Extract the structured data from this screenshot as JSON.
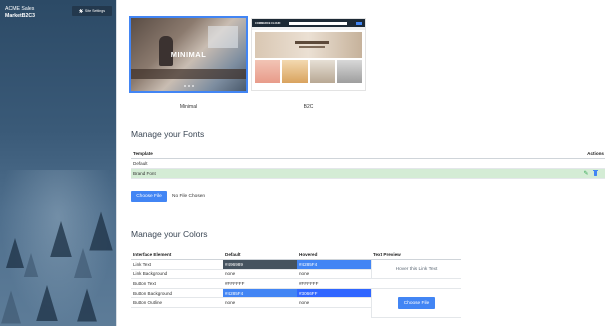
{
  "sidebar": {
    "app_name": "ACME Sales",
    "org_name": "MarketB2C3",
    "site_settings_label": "Site Settings"
  },
  "templates": [
    {
      "name": "Minimal",
      "overlay_text": "MINIMAL",
      "selected": true
    },
    {
      "name": "B2C",
      "logo_text": "COMMERCE CLOUD",
      "selected": false
    }
  ],
  "fonts": {
    "title": "Manage your Fonts",
    "header_template": "Template",
    "header_actions": "Actions",
    "rows": [
      {
        "label": "Default",
        "selected": false
      },
      {
        "label": "Brand Font",
        "selected": true
      }
    ],
    "choose_file_label": "Choose File",
    "no_file_text": "No File Chosen"
  },
  "colors": {
    "title": "Manage your Colors",
    "headers": {
      "element": "Interface Element",
      "default": "Default",
      "hovered": "Hovered",
      "preview": "Text Preview"
    },
    "rows": [
      {
        "element": "Link Text",
        "default": "#496989",
        "hovered": "#4285F4"
      },
      {
        "element": "Link Background",
        "default": "none",
        "hovered": "none"
      },
      {
        "element": "Button Text",
        "default": "#FFFFFF",
        "hovered": "#FFFFFF"
      },
      {
        "element": "Button Background",
        "default": "#4285F4",
        "hovered": "#3066FF"
      },
      {
        "element": "Button Outline",
        "default": "none",
        "hovered": "none"
      }
    ],
    "preview_link_text": "Hover this Link Text",
    "preview_button_label": "Choose File"
  },
  "icons": {
    "settings": "gear-icon",
    "edit": "pencil-icon",
    "delete": "trash-icon"
  },
  "theme": {
    "accent": "#4285F4",
    "accent_hover": "#3066FF",
    "link_default": "#496989",
    "selected_row": "#D4ECD5"
  }
}
